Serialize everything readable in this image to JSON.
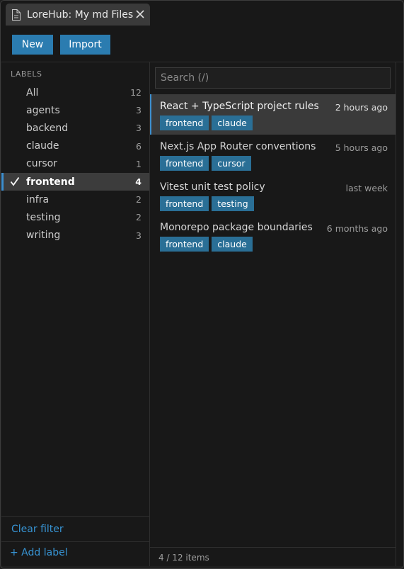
{
  "tab": {
    "title": "LoreHub: My md Files",
    "icon": "file-icon",
    "close_icon": "close-icon"
  },
  "toolbar": {
    "new_label": "New",
    "import_label": "Import"
  },
  "sidebar": {
    "heading": "LABELS",
    "items": [
      {
        "name": "All",
        "count": "12"
      },
      {
        "name": "agents",
        "count": "3"
      },
      {
        "name": "backend",
        "count": "3"
      },
      {
        "name": "claude",
        "count": "6"
      },
      {
        "name": "cursor",
        "count": "1"
      },
      {
        "name": "frontend",
        "count": "4"
      },
      {
        "name": "infra",
        "count": "2"
      },
      {
        "name": "testing",
        "count": "2"
      },
      {
        "name": "writing",
        "count": "3"
      }
    ],
    "active_index": 5,
    "clear_filter": "Clear filter",
    "add_label": "+ Add label"
  },
  "search": {
    "placeholder": "Search (/)",
    "value": ""
  },
  "files": [
    {
      "title": "React + TypeScript project rules",
      "time": "2 hours ago",
      "tags": [
        "frontend",
        "claude"
      ]
    },
    {
      "title": "Next.js App Router conventions",
      "time": "5 hours ago",
      "tags": [
        "frontend",
        "cursor"
      ]
    },
    {
      "title": "Vitest unit test policy",
      "time": "last week",
      "tags": [
        "frontend",
        "testing"
      ]
    },
    {
      "title": "Monorepo package boundaries",
      "time": "6 months ago",
      "tags": [
        "frontend",
        "claude"
      ]
    }
  ],
  "footer": {
    "items_count": "4 / 12 items"
  },
  "colors": {
    "accent": "#2b7cb0",
    "tag": "#2a6f96",
    "link": "#3794d4",
    "active_indicator": "#3c8fcf"
  }
}
